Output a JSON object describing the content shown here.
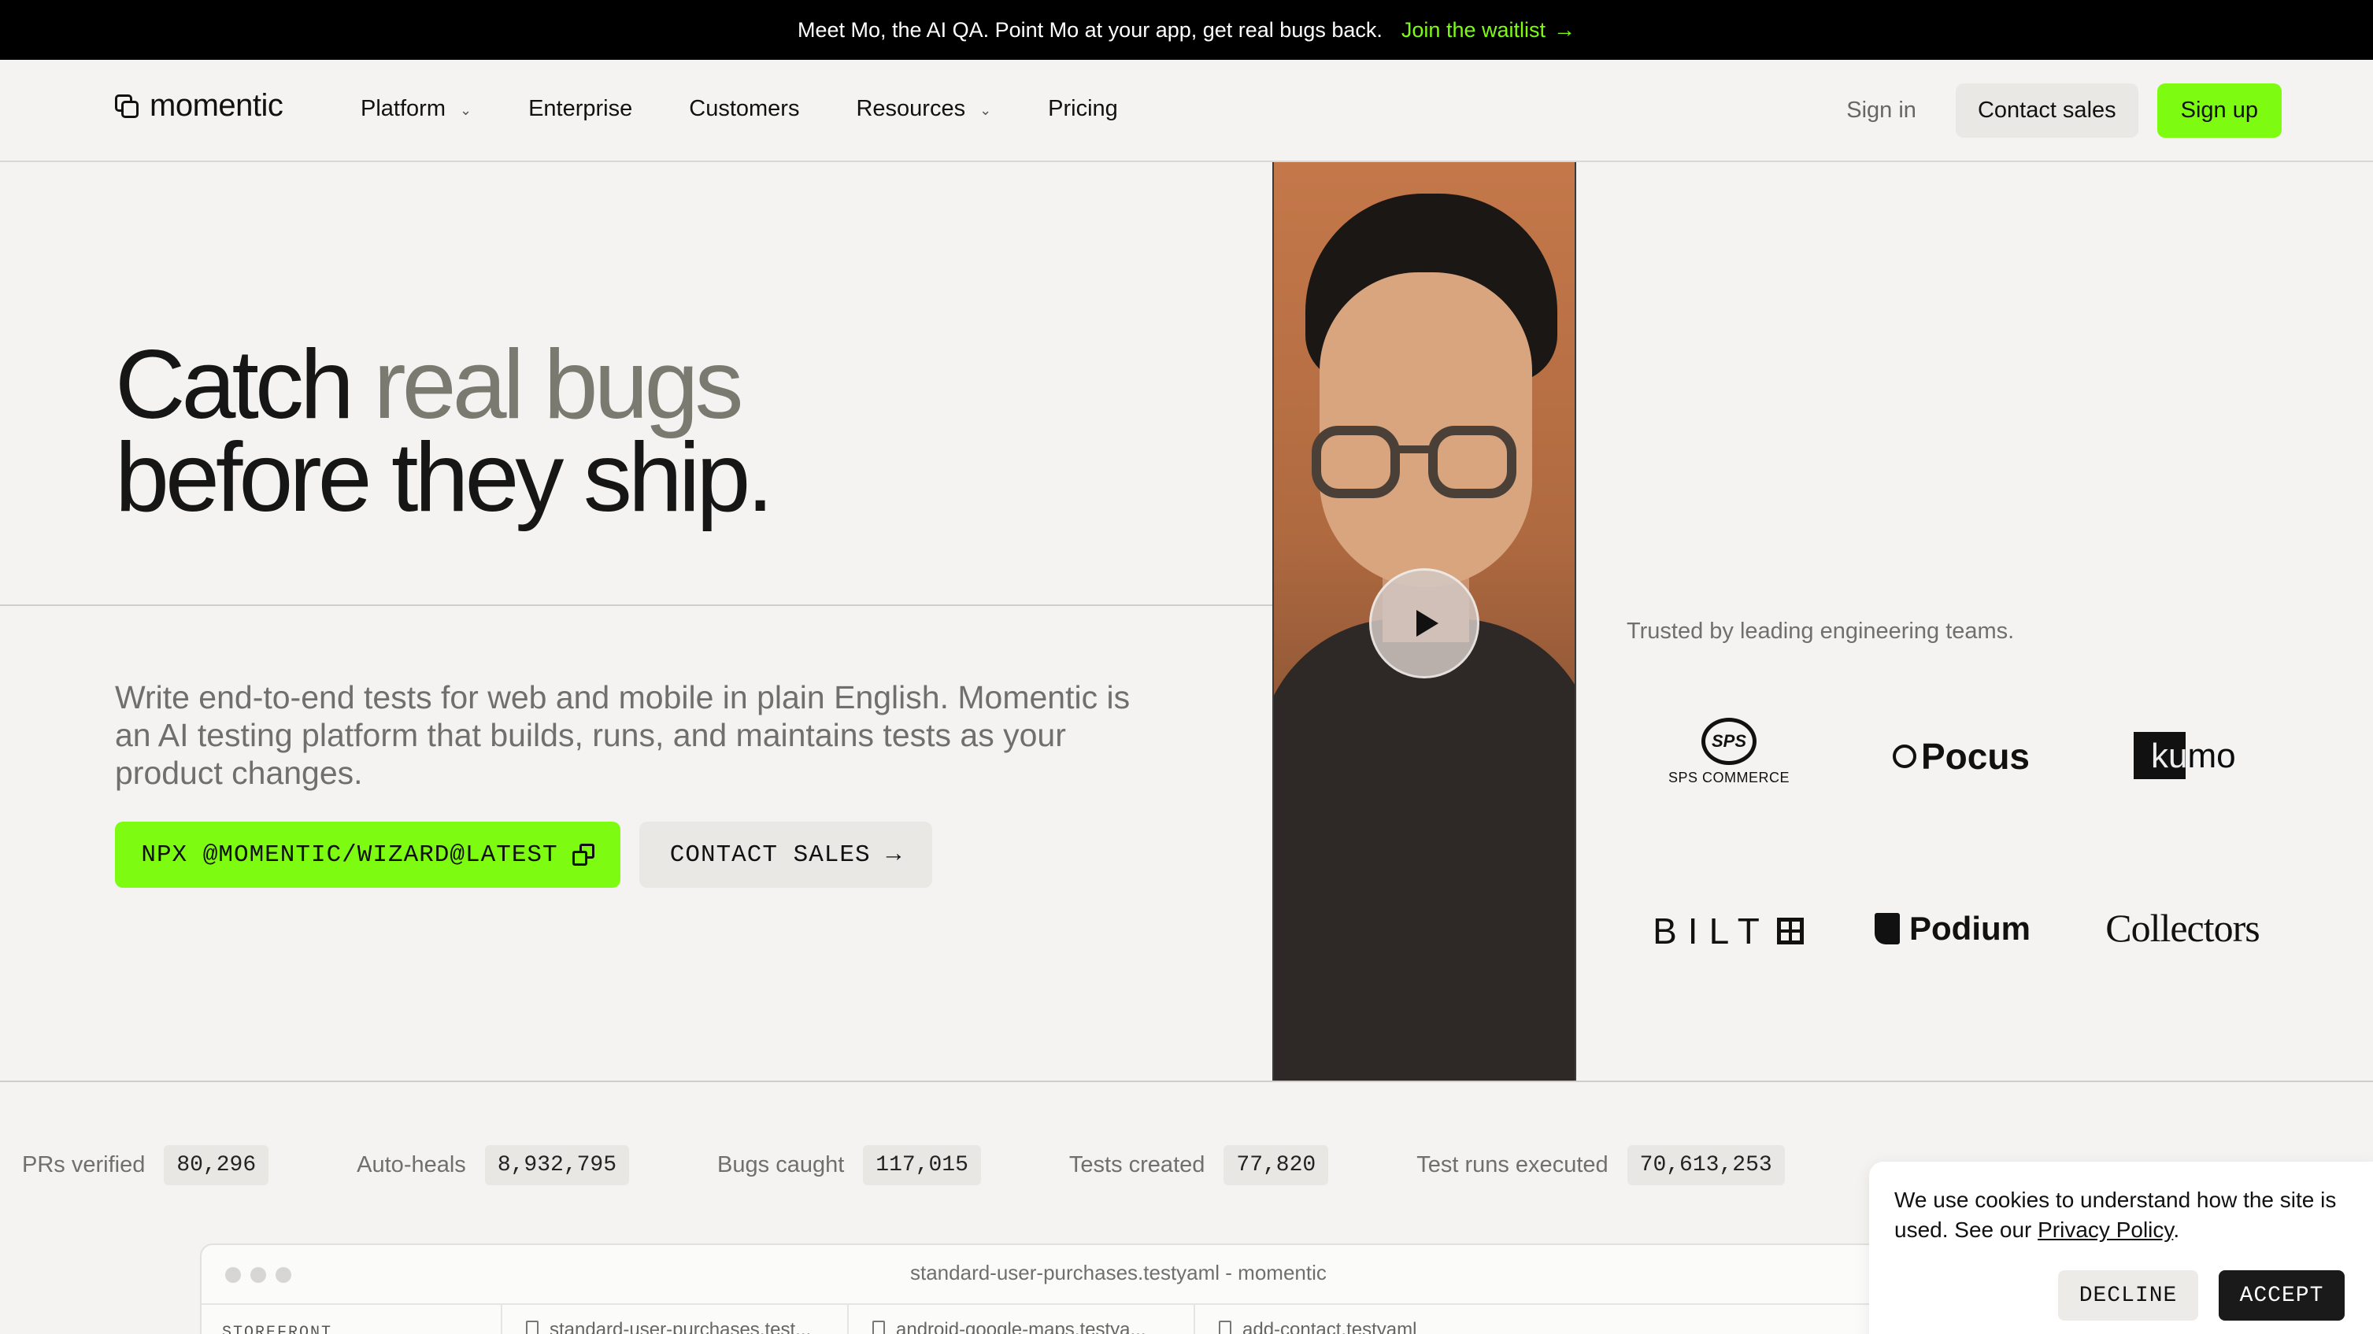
{
  "announcement": {
    "text": "Meet Mo, the AI QA. Point Mo at your app, get real bugs back.",
    "link_label": "Join the waitlist",
    "link_color": "#7dfc12"
  },
  "nav": {
    "logo": "momentic",
    "items": [
      {
        "label": "Platform",
        "dropdown": true
      },
      {
        "label": "Enterprise",
        "dropdown": false
      },
      {
        "label": "Customers",
        "dropdown": false
      },
      {
        "label": "Resources",
        "dropdown": true
      },
      {
        "label": "Pricing",
        "dropdown": false
      }
    ],
    "sign_in": "Sign in",
    "contact_sales": "Contact sales",
    "sign_up": "Sign up"
  },
  "hero": {
    "title_part1": "Catch ",
    "title_highlight": "real bugs",
    "title_line2": "before they ship.",
    "subtitle": "Write end-to-end tests for web and mobile in plain English. Momentic is an AI testing platform that builds, runs, and maintains tests as your product changes.",
    "cta_primary": "NPX @MOMENTIC/WIZARD@LATEST",
    "cta_secondary": "CONTACT SALES"
  },
  "trusted": {
    "heading": "Trusted by leading engineering teams.",
    "logos": {
      "sps_mark": "SPS",
      "sps": "SPS COMMERCE",
      "pocus": "Pocus",
      "kumo": "kumo",
      "bilt": "BILT",
      "podium": "Podium",
      "collectors": "Collectors"
    }
  },
  "stats": [
    {
      "label": "PRs verified",
      "value": "80,296"
    },
    {
      "label": "Auto-heals",
      "value": "8,932,795"
    },
    {
      "label": "Bugs caught",
      "value": "117,015"
    },
    {
      "label": "Tests created",
      "value": "77,820"
    },
    {
      "label": "Test runs executed",
      "value": "70,613,253"
    }
  ],
  "editor": {
    "title": "standard-user-purchases.testyaml - momentic",
    "sidebar_label": "STOREFRONT",
    "tabs": [
      "standard-user-purchases.test...",
      "android-google-maps.testya...",
      "add-contact.testyaml"
    ]
  },
  "cookie": {
    "text": "We use cookies to understand how the site is used. See our ",
    "policy_link": "Privacy Policy",
    "period": ".",
    "decline": "DECLINE",
    "accept": "ACCEPT"
  },
  "colors": {
    "accent": "#7dfc12",
    "background": "#f4f3f1",
    "dark": "#000000"
  }
}
